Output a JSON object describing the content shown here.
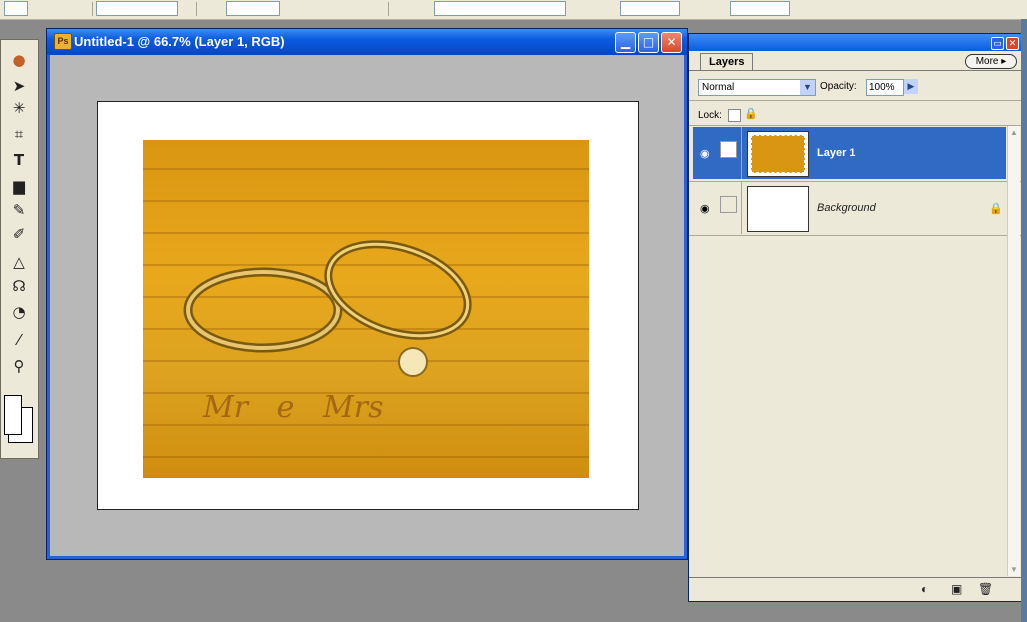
{
  "document": {
    "title": "Untitled-1 @ 66.7% (Layer 1, RGB)",
    "icon": "photoshop-document-icon",
    "photo_text": "Mr   e   Mrs"
  },
  "toolbox": {
    "tools": [
      "marquee-tool-icon",
      "move-tool-icon",
      "magic-wand-icon",
      "crop-tool-icon",
      "type-tool-icon",
      "gradient-tool-icon",
      "brush-tool-icon",
      "eraser-tool-icon",
      "sharpen-tool-icon",
      "smudge-tool-icon",
      "dodge-tool-icon",
      "eyedropper-icon",
      "zoom-tool-icon"
    ]
  },
  "layers_palette": {
    "tab_label": "Layers",
    "more_label": "More ▸",
    "blend_mode": "Normal",
    "opacity_label": "Opacity:",
    "opacity_value": "100%",
    "lock_label": "Lock:",
    "layers": [
      {
        "name": "Layer 1",
        "selected": true,
        "locked": false
      },
      {
        "name": "Background",
        "selected": false,
        "locked": true
      }
    ]
  },
  "colors": {
    "titlebar": "#0a5be0",
    "selection": "#316ac5",
    "photo_tint": "#d99612"
  }
}
